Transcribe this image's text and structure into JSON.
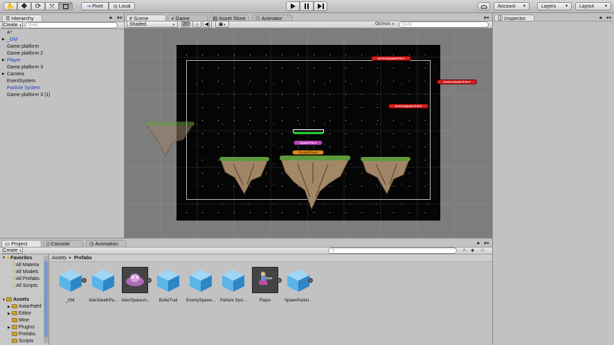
{
  "toolbar": {
    "pivot_label": "Pivot",
    "local_label": "Local",
    "account_label": "Account",
    "layers_label": "Layers",
    "layout_label": "Layout"
  },
  "hierarchy": {
    "tab_label": "Hierarchy",
    "create_label": "Create",
    "search_placeholder": "Q•All",
    "scene_name": "A*",
    "items": [
      {
        "label": "_GM",
        "color": "blue",
        "foldout": true
      },
      {
        "label": "Game platform",
        "color": "black",
        "foldout": false
      },
      {
        "label": "Game platform 2",
        "color": "black",
        "foldout": false
      },
      {
        "label": "Player",
        "color": "blue",
        "foldout": true
      },
      {
        "label": "Game platform 3",
        "color": "black",
        "foldout": false
      },
      {
        "label": "Camera",
        "color": "black",
        "foldout": true
      },
      {
        "label": "EventSystem",
        "color": "black",
        "foldout": false
      },
      {
        "label": "Particle System",
        "color": "blue",
        "foldout": false
      },
      {
        "label": "Game platform 3 (1)",
        "color": "black",
        "foldout": false
      }
    ]
  },
  "center_tabs": {
    "scene": "Scene",
    "game": "Game",
    "asset_store": "Asset Store",
    "animator": "Animator"
  },
  "scene_toolbar": {
    "shading": "Shaded",
    "mode_2d": "2D",
    "gizmos": "Gizmos",
    "search_placeholder": "Q•All"
  },
  "scene_labels": {
    "enemy_spawn_1": "EnemySpawnPoint",
    "enemy_spawn_2": "EnemySpawnPoint",
    "enemy_spawn_3": "EnemySpawnPoint",
    "spawn_point": "SpawnPoint",
    "ground_check": "GroundCheck"
  },
  "inspector": {
    "tab_label": "Inspector"
  },
  "bottom_tabs": {
    "project": "Project",
    "console": "Console",
    "animation": "Animation"
  },
  "project": {
    "create_label": "Create",
    "favorites_label": "Favorites",
    "favorites": [
      "All Materia",
      "All Models",
      "All Prefabs",
      "All Scripts"
    ],
    "assets_label": "Assets",
    "asset_folders": [
      "AstarPathf",
      "Editor",
      "Mine",
      "Plugins",
      "Prefabs",
      "Scripts"
    ],
    "breadcrumb_root": "Assets",
    "breadcrumb_sep": "►",
    "breadcrumb_current": "Prefabs",
    "prefabs": [
      {
        "label": "_GM",
        "kind": "cube"
      },
      {
        "label": "AlienDeathPa...",
        "kind": "cube"
      },
      {
        "label": "AlienSpacesh...",
        "kind": "ship"
      },
      {
        "label": "BulletTrail",
        "kind": "cube"
      },
      {
        "label": "EnemySpawn...",
        "kind": "cube"
      },
      {
        "label": "Particle Syst...",
        "kind": "cube"
      },
      {
        "label": "Player",
        "kind": "player"
      },
      {
        "label": "SpawnParticl...",
        "kind": "cube"
      }
    ]
  },
  "colors": {
    "cube_face": "#5ab4e8",
    "cube_top": "#9fd6f6",
    "cube_side": "#2e86c4",
    "enemy_label": "#d42020",
    "spawn_label": "#c040c0",
    "ground_label": "#e08a1a",
    "grass": "#5c9a3c"
  }
}
